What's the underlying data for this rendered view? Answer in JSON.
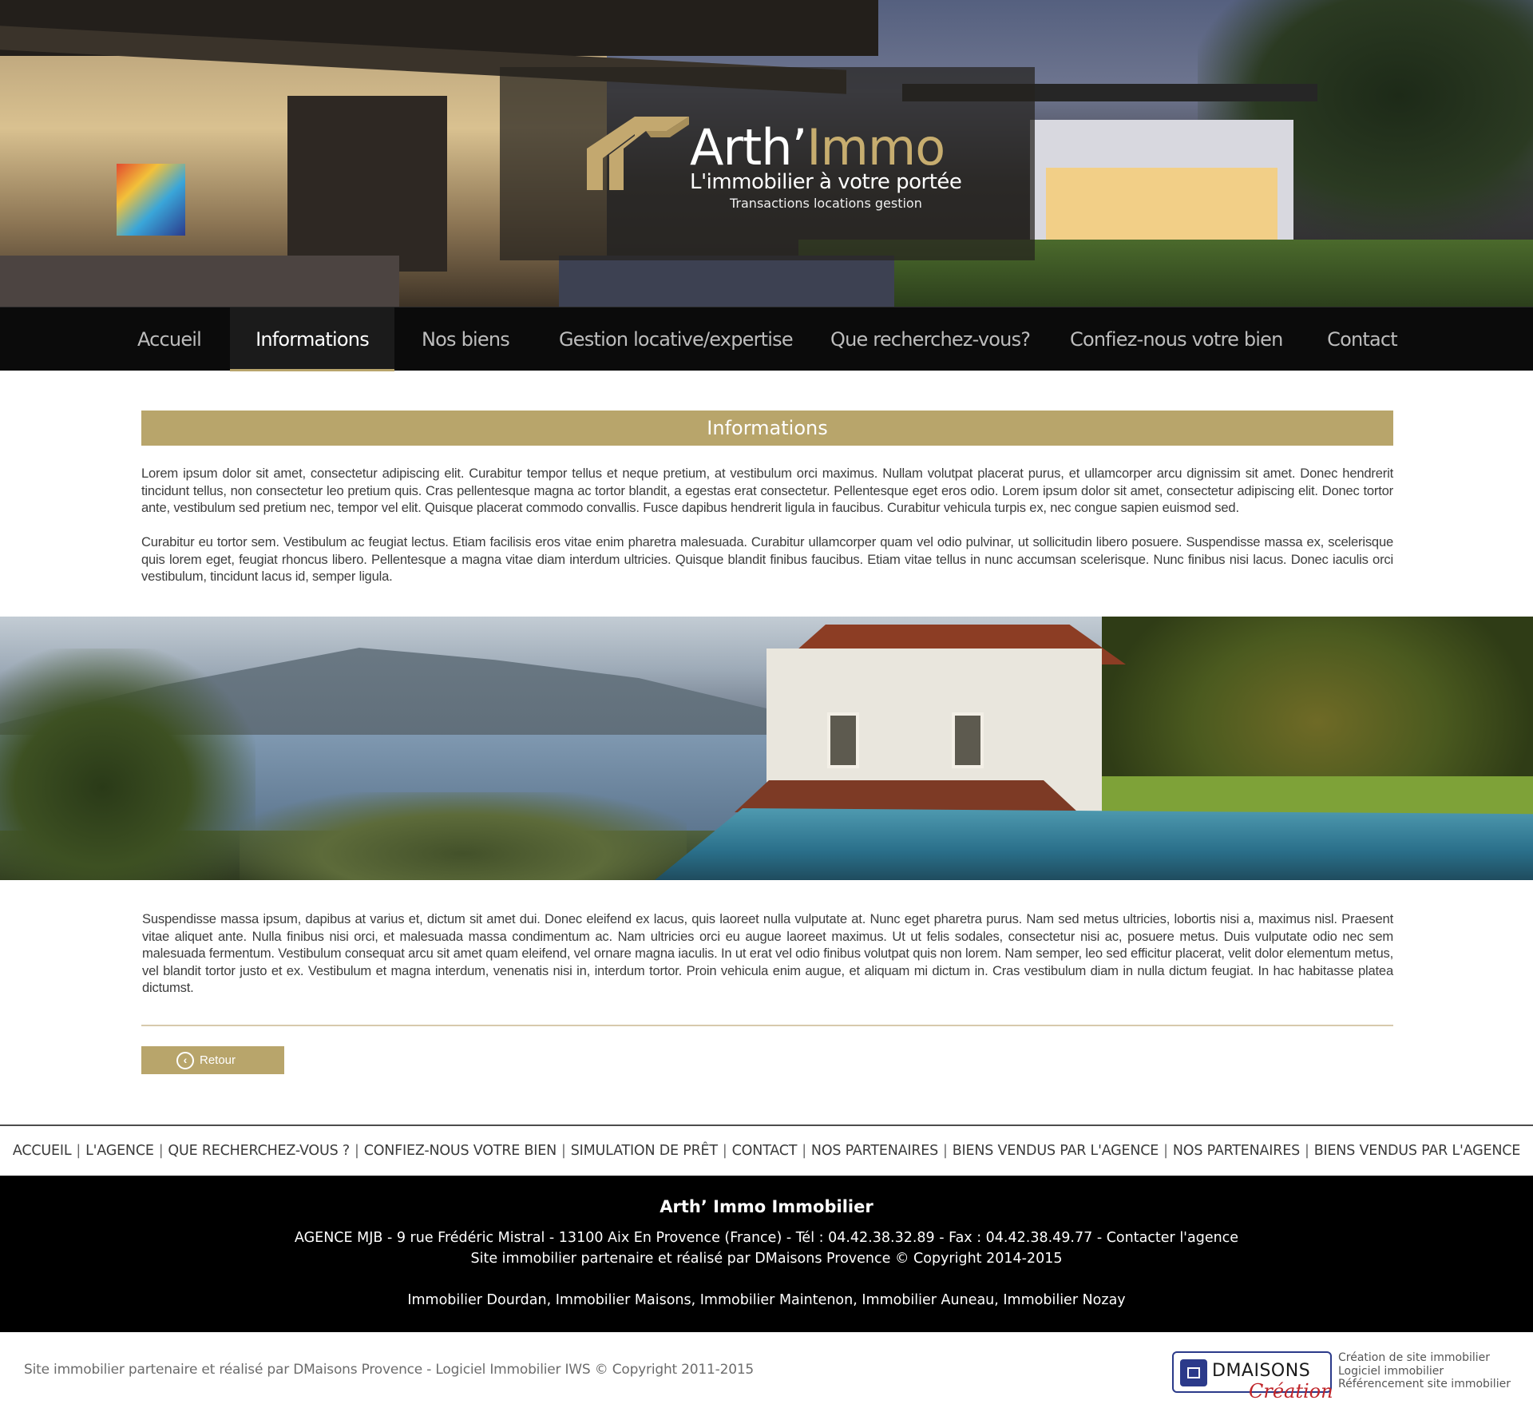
{
  "brand": {
    "name_main": "Arth’",
    "name_accent": "Immo",
    "tagline": "L'immobilier à votre portée",
    "subtitle": "Transactions locations gestion",
    "accent_color": "#b8a56b"
  },
  "nav": {
    "items": [
      {
        "label": "Accueil",
        "active": false
      },
      {
        "label": "Informations",
        "active": true
      },
      {
        "label": "Nos biens",
        "active": false
      },
      {
        "label": "Gestion locative/expertise",
        "active": false
      },
      {
        "label": "Que recherchez-vous?",
        "active": false
      },
      {
        "label": "Confiez-nous votre bien",
        "active": false
      },
      {
        "label": "Contact",
        "active": false
      }
    ]
  },
  "content": {
    "title": "Informations",
    "paragraph_1": "Lorem ipsum dolor sit amet, consectetur adipiscing elit. Curabitur tempor tellus et neque pretium, at vestibulum orci maximus. Nullam volutpat placerat purus, et ullamcorper arcu dignissim sit amet. Donec hendrerit tincidunt tellus, non consectetur leo pretium quis. Cras pellentesque magna ac tortor blandit, a egestas erat consectetur. Pellentesque eget eros odio. Lorem ipsum dolor sit amet, consectetur adipiscing elit. Donec tortor ante, vestibulum sed pretium nec, tempor vel elit. Quisque placerat commodo convallis. Fusce dapibus hendrerit ligula in faucibus. Curabitur vehicula turpis ex, nec congue sapien euismod sed.",
    "paragraph_2": "Curabitur eu tortor sem. Vestibulum ac feugiat lectus. Etiam facilisis eros vitae enim pharetra malesuada. Curabitur ullamcorper quam vel odio pulvinar, ut sollicitudin libero posuere. Suspendisse massa ex, scelerisque quis lorem eget, feugiat rhoncus libero. Pellentesque a magna vitae diam interdum ultricies. Quisque blandit finibus faucibus. Etiam vitae tellus in nunc accumsan scelerisque. Nunc finibus nisi lacus. Donec iaculis orci vestibulum, tincidunt lacus id, semper ligula.",
    "paragraph_3": "Suspendisse massa ipsum, dapibus at varius et, dictum sit amet dui. Donec eleifend ex lacus, quis laoreet nulla vulputate at. Nunc eget pharetra purus. Nam sed metus ultricies, lobortis nisi a, maximus nisl. Praesent vitae aliquet ante. Nulla finibus nisi orci, et malesuada massa condimentum ac. Nam ultricies orci eu augue laoreet maximus. Ut ut felis sodales, consectetur nisi ac, posuere metus. Duis vulputate odio nec sem malesuada fermentum. Vestibulum consequat arcu sit amet quam eleifend, vel ornare magna iaculis. In ut erat vel odio finibus volutpat quis non lorem. Nam semper, leo sed efficitur placerat, velit dolor elementum metus, vel blandit tortor justo et ex. Vestibulum et magna interdum, venenatis nisi in, interdum tortor. Proin vehicula enim augue, et aliquam mi dictum in. Cras vestibulum diam in nulla dictum feugiat. In hac habitasse platea dictumst.",
    "back_label": "Retour",
    "back_icon": "chevron-left-circle-icon"
  },
  "footer": {
    "links": [
      "ACCUEIL",
      "L'AGENCE",
      "QUE RECHERCHEZ-VOUS ?",
      "CONFIEZ-NOUS VOTRE BIEN",
      "SIMULATION DE PRÊT",
      "CONTACT",
      "NOS PARTENAIRES",
      "BIENS VENDUS PAR L'AGENCE",
      "NOS PARTENAIRES",
      "BIENS VENDUS PAR L'AGENCE"
    ],
    "separator": "|",
    "company": "Arth’ Immo Immobilier",
    "address": "AGENCE MJB - 9 rue Frédéric Mistral - 13100 Aix En Provence (France) - Tél : 04.42.38.32.89 - Fax : 04.42.38.49.77 - ",
    "contact_link": "Contacter l'agence",
    "credit": "Site immobilier partenaire et réalisé par DMaisons Provence © Copyright 2014-2015",
    "cities": "Immobilier Dourdan, Immobilier Maisons, Immobilier Maintenon, Immobilier Auneau, Immobilier Nozay",
    "bottom_credit": "Site immobilier partenaire et réalisé par DMaisons Provence - Logiciel Immobilier IWS © Copyright 2011-2015",
    "partner_logo": {
      "word": "DMAISONS",
      "script": "Création",
      "brand_color": "#2b3a8a",
      "script_color": "#c0252a"
    },
    "partner_services": [
      "Création de site immobilier",
      "Logiciel immobilier",
      "Référencement site immobilier"
    ]
  }
}
